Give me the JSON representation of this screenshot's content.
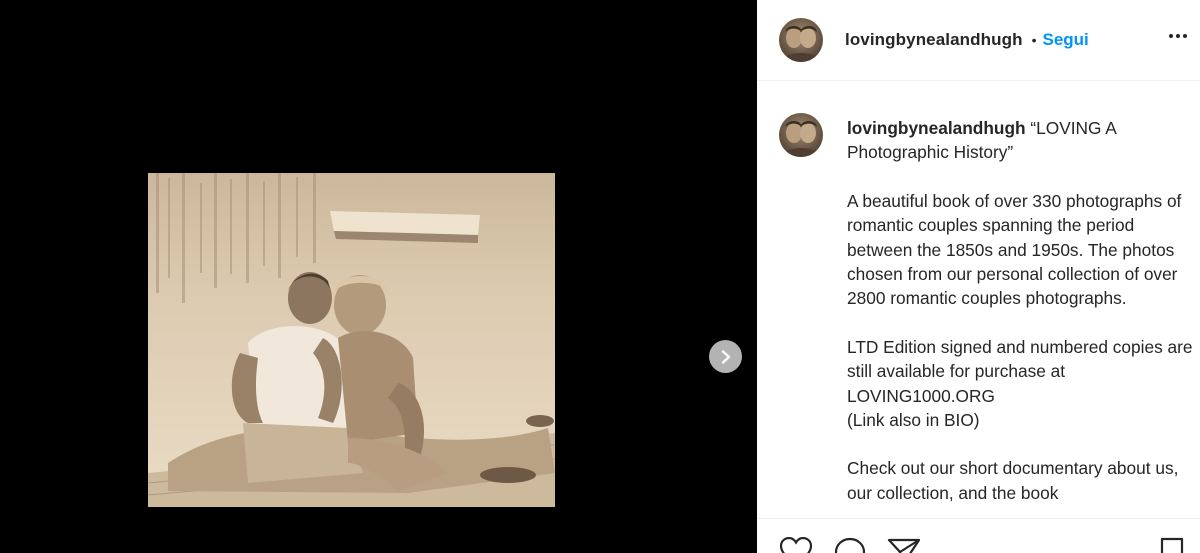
{
  "post": {
    "username": "lovingbynealandhugh",
    "dot": "•",
    "follow_label": "Segui"
  },
  "caption": {
    "username": "lovingbynealandhugh",
    "title": "“LOVING A Photographic History”",
    "paragraphs": [
      "A beautiful book of over 330 photographs of romantic couples spanning the period between the 1850s and 1950s. The photos chosen from our personal collection of over 2800 romantic couples photographs.",
      "LTD Edition signed and numbered copies are still available for purchase at LOVING1000.ORG",
      "(Link also in BIO)",
      "Check out our short documentary about us, our collection, and the book"
    ]
  },
  "icons": {
    "next": "chevron-right-icon",
    "more": "more-options-icon",
    "like": "heart-icon",
    "comment": "comment-icon",
    "share": "paper-plane-icon",
    "save": "bookmark-icon"
  },
  "colors": {
    "follow": "#0095f6",
    "text": "#262626",
    "media_bg": "#000000"
  }
}
